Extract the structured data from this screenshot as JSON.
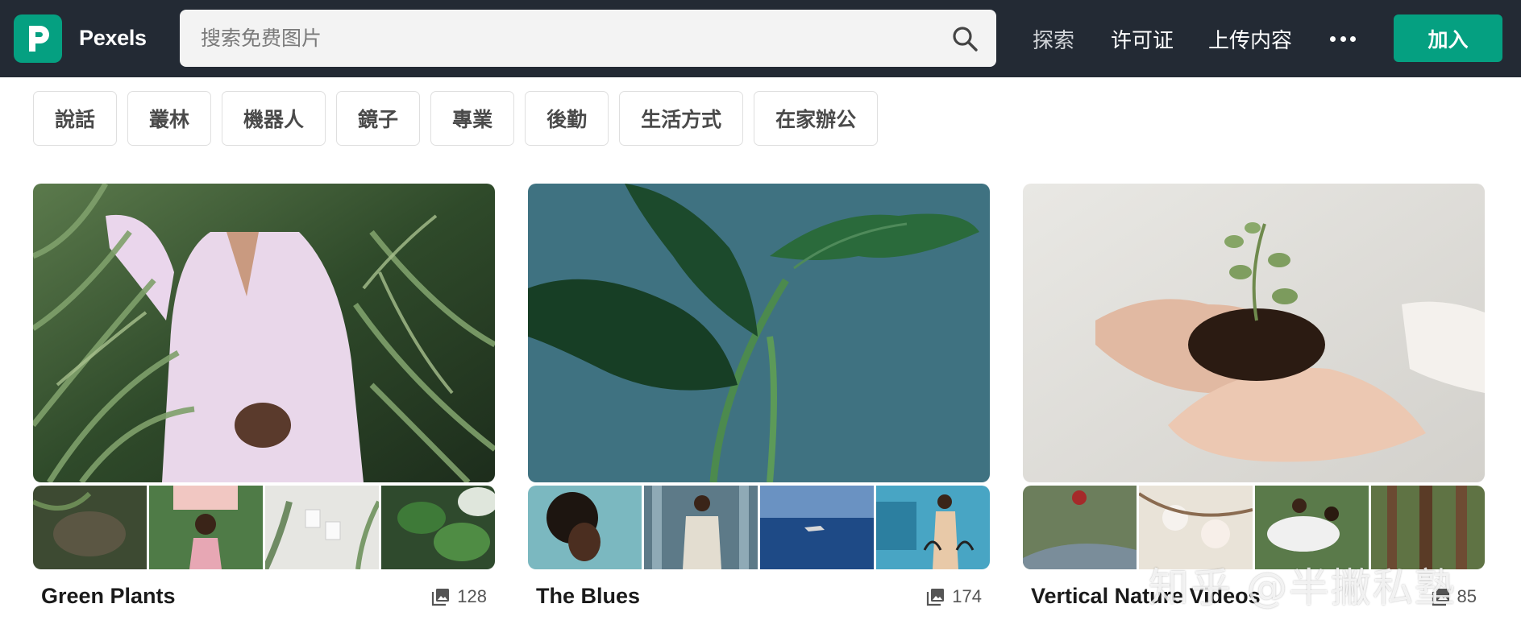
{
  "header": {
    "brand": "Pexels",
    "search_placeholder": "搜索免费图片",
    "nav": {
      "explore": "探索",
      "license": "许可证",
      "upload": "上传内容"
    },
    "join_label": "加入",
    "icons": {
      "logo": "pexels-logo-icon",
      "search": "search-icon",
      "more": "more-icon"
    }
  },
  "tags": [
    "說話",
    "叢林",
    "機器人",
    "鏡子",
    "專業",
    "後勤",
    "生活方式",
    "在家辦公"
  ],
  "collections": [
    {
      "title": "Green Plants",
      "count": "128"
    },
    {
      "title": "The Blues",
      "count": "174"
    },
    {
      "title": "Vertical Nature Videos",
      "count": "85"
    }
  ],
  "colors": {
    "header_bg": "#232a34",
    "accent": "#05a081"
  },
  "watermark": "知乎 @半撇私塾"
}
